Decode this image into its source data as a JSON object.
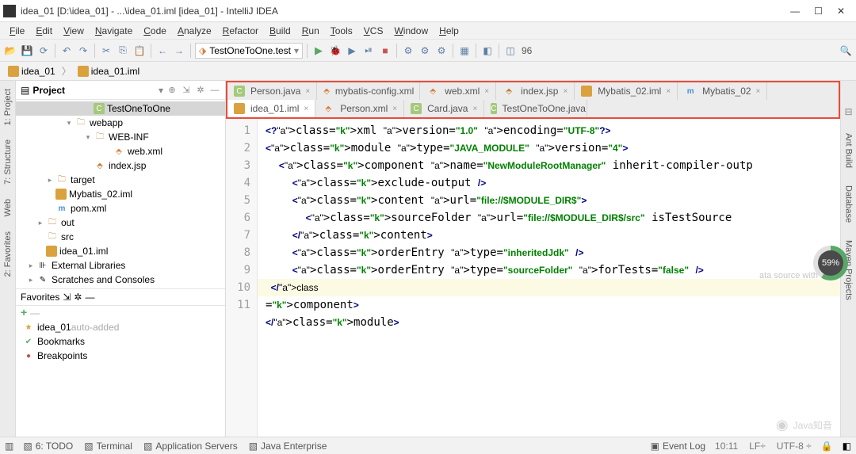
{
  "title": "idea_01 [D:\\idea_01] - ...\\idea_01.iml [idea_01] - IntelliJ IDEA",
  "menu": [
    "File",
    "Edit",
    "View",
    "Navigate",
    "Code",
    "Analyze",
    "Refactor",
    "Build",
    "Run",
    "Tools",
    "VCS",
    "Window",
    "Help"
  ],
  "toolbar": {
    "run_config": "TestOneToOne.test",
    "counter": "96"
  },
  "breadcrumb": [
    {
      "icon": "mod",
      "label": "idea_01"
    },
    {
      "icon": "mod",
      "label": "idea_01.iml"
    }
  ],
  "project": {
    "title": "Project",
    "tree": [
      {
        "indent": 7,
        "tw": "",
        "icon": "c",
        "label": "TestOneToOne",
        "sel": true
      },
      {
        "indent": 5,
        "tw": "▾",
        "icon": "folder",
        "label": "webapp"
      },
      {
        "indent": 7,
        "tw": "▾",
        "icon": "folder",
        "label": "WEB-INF"
      },
      {
        "indent": 9,
        "tw": "",
        "icon": "xml",
        "label": "web.xml"
      },
      {
        "indent": 7,
        "tw": "",
        "icon": "jsp",
        "label": "index.jsp"
      },
      {
        "indent": 3,
        "tw": "▸",
        "icon": "folder-red",
        "label": "target"
      },
      {
        "indent": 3,
        "tw": "",
        "icon": "mod",
        "label": "Mybatis_02.iml"
      },
      {
        "indent": 3,
        "tw": "",
        "icon": "m",
        "label": "pom.xml"
      },
      {
        "indent": 2,
        "tw": "▸",
        "icon": "folder-red",
        "label": "out"
      },
      {
        "indent": 2,
        "tw": "",
        "icon": "folder",
        "label": "src"
      },
      {
        "indent": 2,
        "tw": "",
        "icon": "mod",
        "label": "idea_01.iml"
      },
      {
        "indent": 1,
        "tw": "▸",
        "icon": "lib",
        "label": "External Libraries"
      },
      {
        "indent": 1,
        "tw": "▸",
        "icon": "scratch",
        "label": "Scratches and Consoles"
      }
    ]
  },
  "favorites": {
    "title": "Favorites",
    "items": [
      {
        "icon": "star",
        "label": "idea_01",
        "suffix": "auto-added"
      },
      {
        "icon": "bookmark",
        "label": "Bookmarks"
      },
      {
        "icon": "bp",
        "label": "Breakpoints"
      }
    ]
  },
  "left_tabs": [
    "1: Project",
    "7: Structure",
    "Web",
    "2: Favorites"
  ],
  "right_tabs": [
    "Ant Build",
    "Database",
    "Maven Projects"
  ],
  "tabs_row1": [
    {
      "icon": "c",
      "label": "Person.java"
    },
    {
      "icon": "xml",
      "label": "mybatis-config.xml"
    },
    {
      "icon": "xml",
      "label": "web.xml"
    },
    {
      "icon": "jsp",
      "label": "index.jsp"
    },
    {
      "icon": "mod",
      "label": "Mybatis_02.iml"
    },
    {
      "icon": "m",
      "label": "Mybatis_02"
    }
  ],
  "tabs_row2": [
    {
      "icon": "mod",
      "label": "idea_01.iml",
      "active": true
    },
    {
      "icon": "xml",
      "label": "Person.xml"
    },
    {
      "icon": "c",
      "label": "Card.java"
    },
    {
      "icon": "c",
      "label": "TestOneToOne.java"
    }
  ],
  "code_lines": [
    "<?xml version=\"1.0\" encoding=\"UTF-8\"?>",
    "<module type=\"JAVA_MODULE\" version=\"4\">",
    "  <component name=\"NewModuleRootManager\" inherit-compiler-outp",
    "    <exclude-output />",
    "    <content url=\"file://$MODULE_DIR$\">",
    "      <sourceFolder url=\"file://$MODULE_DIR$/src\" isTestSource",
    "    </content>",
    "    <orderEntry type=\"inheritedJdk\" />",
    "    <orderEntry type=\"sourceFolder\" forTests=\"false\" />",
    "  </component>",
    "</module>"
  ],
  "ghost": "ata source with",
  "progress": "59%",
  "statusbar": {
    "items": [
      "6: TODO",
      "Terminal",
      "Application Servers",
      "Java Enterprise"
    ],
    "right": [
      "Event Log"
    ],
    "info": [
      "10:11",
      "LF÷",
      "UTF-8 ÷"
    ]
  },
  "watermark": "Java知音"
}
